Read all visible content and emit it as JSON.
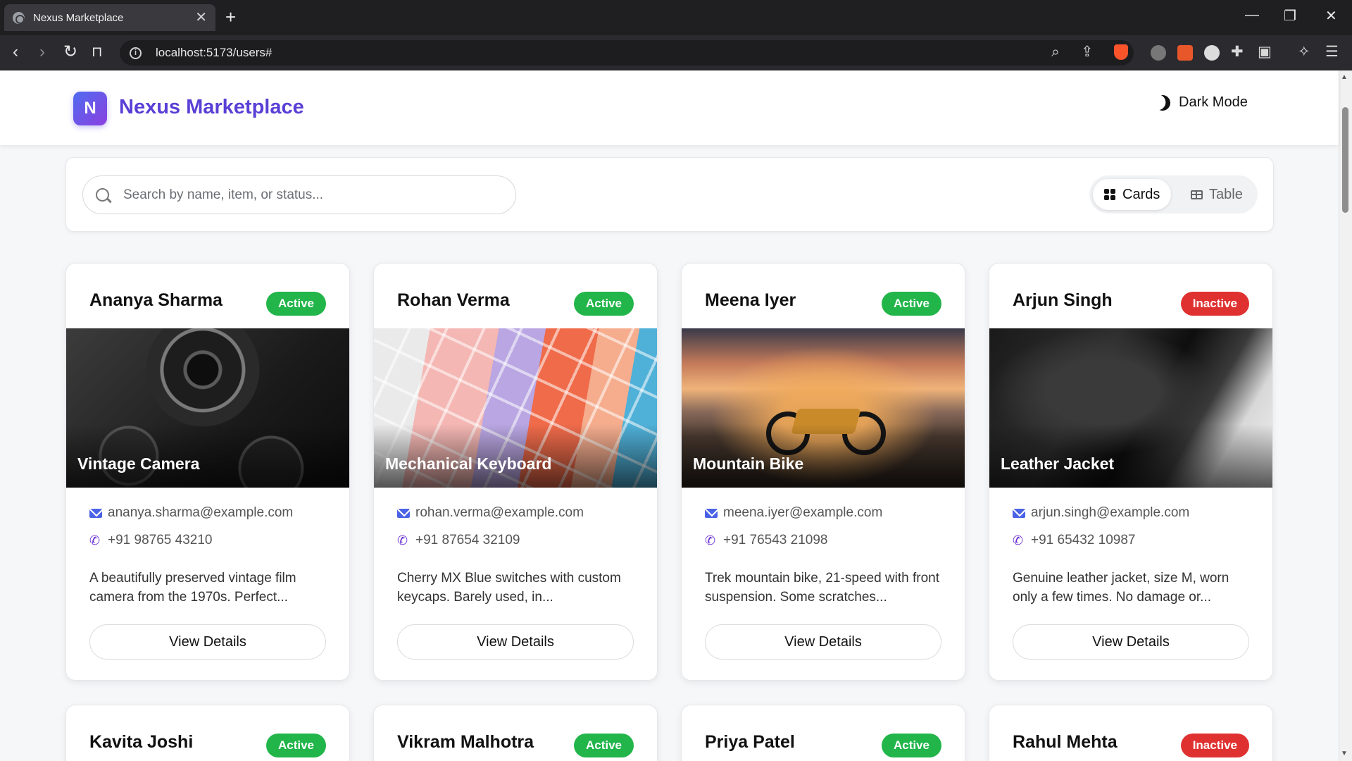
{
  "browser": {
    "tab_title": "Nexus Marketplace",
    "tab_close": "✕",
    "new_tab": "+",
    "url": "localhost:5173/users#",
    "minimize": "—",
    "restore": "❐",
    "close": "✕"
  },
  "header": {
    "logo_letter": "N",
    "brand": "Nexus Marketplace",
    "dark_mode_label": "Dark Mode"
  },
  "search": {
    "placeholder": "Search by name, item, or status...",
    "value": ""
  },
  "view_toggle": {
    "cards_label": "Cards",
    "table_label": "Table",
    "selected": "Cards"
  },
  "colors": {
    "accent": "#5a3fd6",
    "active_badge": "#22b54a",
    "inactive_badge": "#e03131"
  },
  "cards": [
    {
      "name": "Ananya Sharma",
      "status": "Active",
      "item": "Vintage Camera",
      "email": "ananya.sharma@example.com",
      "phone": "+91 98765 43210",
      "description": "A beautifully preserved vintage film camera from the 1970s. Perfect...",
      "button": "View Details"
    },
    {
      "name": "Rohan Verma",
      "status": "Active",
      "item": "Mechanical Keyboard",
      "email": "rohan.verma@example.com",
      "phone": "+91 87654 32109",
      "description": "Cherry MX Blue switches with custom keycaps. Barely used, in...",
      "button": "View Details"
    },
    {
      "name": "Meena Iyer",
      "status": "Active",
      "item": "Mountain Bike",
      "email": "meena.iyer@example.com",
      "phone": "+91 76543 21098",
      "description": "Trek mountain bike, 21-speed with front suspension. Some scratches...",
      "button": "View Details"
    },
    {
      "name": "Arjun Singh",
      "status": "Inactive",
      "item": "Leather Jacket",
      "email": "arjun.singh@example.com",
      "phone": "+91 65432 10987",
      "description": "Genuine leather jacket, size M, worn only a few times. No damage or...",
      "button": "View Details"
    },
    {
      "name": "Kavita Joshi",
      "status": "Active"
    },
    {
      "name": "Vikram Malhotra",
      "status": "Active"
    },
    {
      "name": "Priya Patel",
      "status": "Active"
    },
    {
      "name": "Rahul Mehta",
      "status": "Inactive"
    }
  ]
}
